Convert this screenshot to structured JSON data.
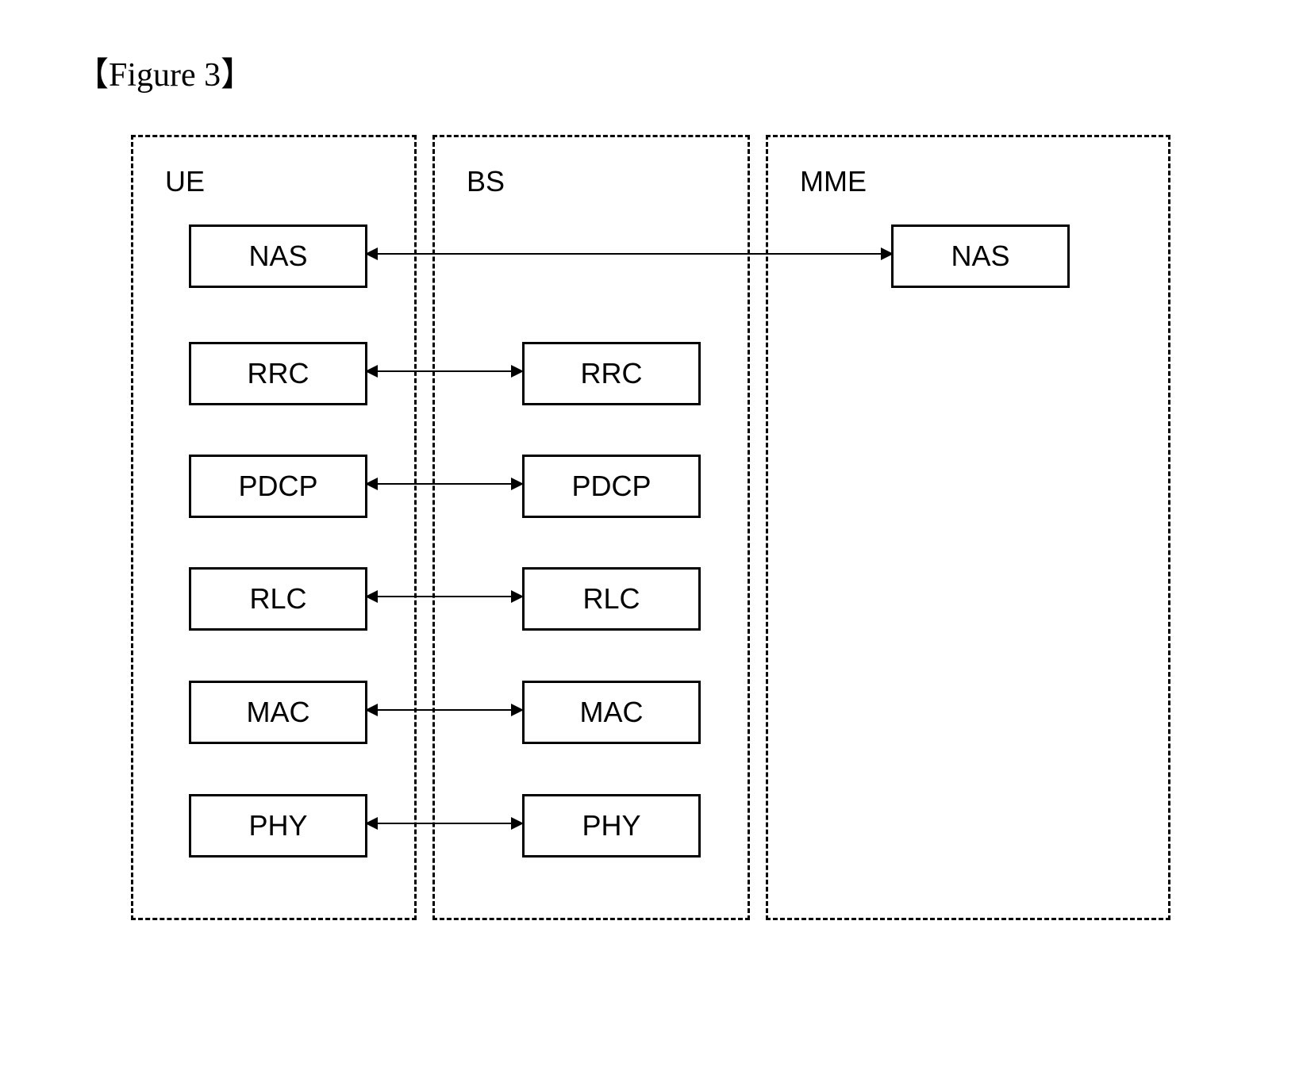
{
  "figure_label": "【Figure 3】",
  "columns": {
    "ue": {
      "label": "UE"
    },
    "bs": {
      "label": "BS"
    },
    "mme": {
      "label": "MME"
    }
  },
  "layers": {
    "nas": "NAS",
    "rrc": "RRC",
    "pdcp": "PDCP",
    "rlc": "RLC",
    "mac": "MAC",
    "phy": "PHY"
  }
}
